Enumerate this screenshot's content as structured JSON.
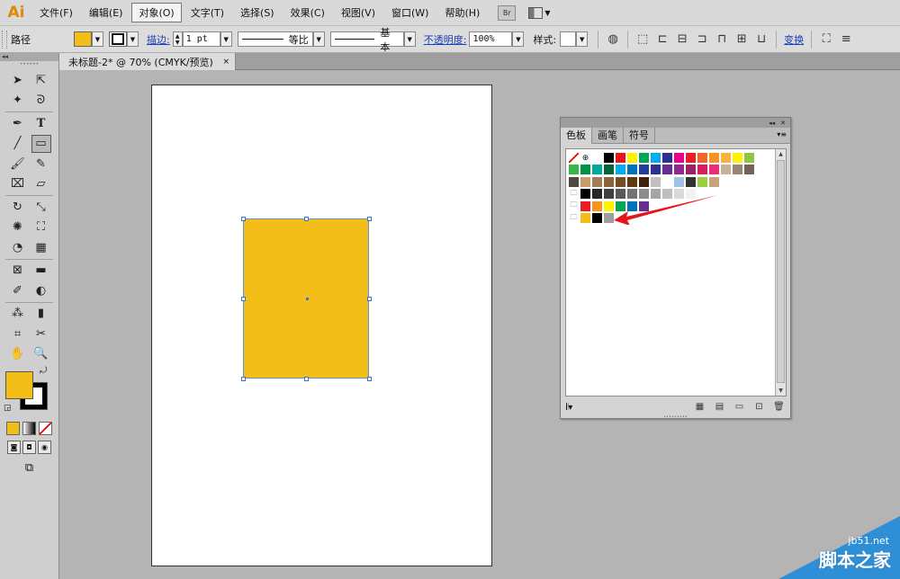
{
  "app": {
    "logo": "Ai"
  },
  "menu": {
    "items": [
      {
        "label": "文件(F)",
        "active": false
      },
      {
        "label": "编辑(E)",
        "active": false
      },
      {
        "label": "对象(O)",
        "active": true
      },
      {
        "label": "文字(T)",
        "active": false
      },
      {
        "label": "选择(S)",
        "active": false
      },
      {
        "label": "效果(C)",
        "active": false
      },
      {
        "label": "视图(V)",
        "active": false
      },
      {
        "label": "窗口(W)",
        "active": false
      },
      {
        "label": "帮助(H)",
        "active": false
      }
    ],
    "bridge": "Br"
  },
  "control": {
    "object_type": "路径",
    "fill_color": "#f2be17",
    "stroke_link": "描边:",
    "stroke_weight": "1 pt",
    "profile": "等比",
    "brush": "基本",
    "opacity_link": "不透明度:",
    "opacity_value": "100%",
    "style_label": "样式:",
    "transform_link": "变换"
  },
  "document": {
    "tab_title": "未标题-2* @ 70% (CMYK/预览)",
    "close": "×"
  },
  "tools": {
    "fill_color": "#f2be17",
    "stroke_color": "#000000"
  },
  "artwork": {
    "rect_color": "#f2be17"
  },
  "swatches_panel": {
    "tabs": [
      {
        "label": "色板",
        "active": true
      },
      {
        "label": "画笔",
        "active": false
      },
      {
        "label": "符号",
        "active": false
      }
    ],
    "rows": [
      [
        "none",
        "registration",
        "#ffffff",
        "#000000",
        "#e6161e",
        "#fff200",
        "#00a651",
        "#00aeef",
        "#2e3192",
        "#ec008c",
        "#ed1c24",
        "#f26522",
        "#f7941d",
        "#fbb040",
        "#fff200",
        "#8dc63f"
      ],
      [
        "#39b54a",
        "#009444",
        "#00a99d",
        "#006838",
        "#00aeef",
        "#0072bc",
        "#21409a",
        "#2e3192",
        "#662d91",
        "#92278f",
        "#9e1f63",
        "#da1c5c",
        "#ee2a7b",
        "#c7b299",
        "#998675",
        "#736357"
      ],
      [
        "#534741",
        "#c69c6d",
        "#a67c52",
        "#8c6239",
        "#754c24",
        "#603913",
        "#42210b",
        "#c0c0c0",
        "#ffffff",
        "#9ec3e6",
        "#333333",
        "#9ad03f",
        "#c9a27a"
      ],
      [
        "folder",
        "#000000",
        "#262626",
        "#404040",
        "#595959",
        "#737373",
        "#8c8c8c",
        "#a6a6a6",
        "#bfbfbf",
        "#d9d9d9",
        "#f2f2f2",
        "#ffffff"
      ],
      [
        "folder",
        "#ed1c24",
        "#f7941d",
        "#fff200",
        "#00a651",
        "#0072bc",
        "#662d91"
      ],
      [
        "folder",
        "#f2be17",
        "#000000",
        "#9e9e9e"
      ]
    ]
  },
  "watermark": {
    "url": "jb51.net",
    "text": "脚本之家"
  }
}
